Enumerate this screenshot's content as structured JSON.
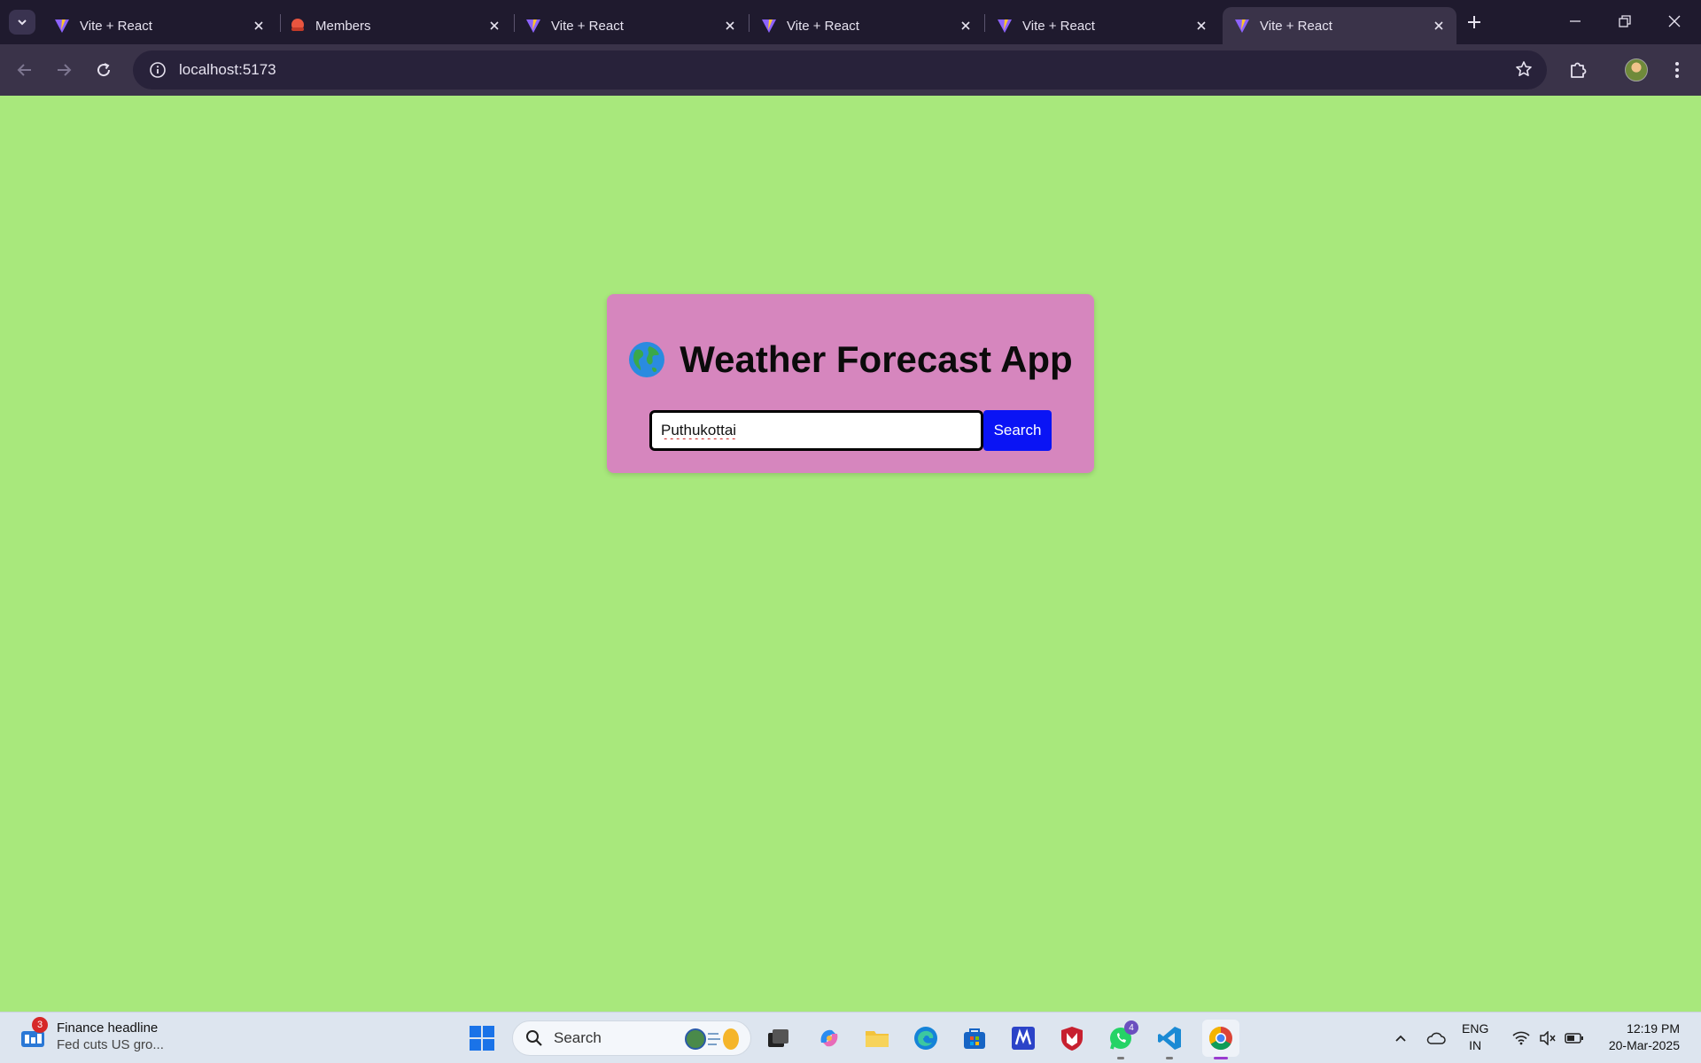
{
  "browser": {
    "tabs": [
      {
        "title": "Vite + React",
        "favicon": "vite-icon",
        "active": false
      },
      {
        "title": "Members",
        "favicon": "members-icon",
        "active": false
      },
      {
        "title": "Vite + React",
        "favicon": "vite-icon",
        "active": false
      },
      {
        "title": "Vite + React",
        "favicon": "vite-icon",
        "active": false
      },
      {
        "title": "Vite + React",
        "favicon": "vite-icon",
        "active": false
      },
      {
        "title": "Vite + React",
        "favicon": "vite-icon",
        "active": true
      }
    ],
    "url": "localhost:5173"
  },
  "app": {
    "title": "Weather Forecast App",
    "title_icon": "globe-icon",
    "search_value": "Puthukottai",
    "search_button": "Search",
    "colors": {
      "background": "#a8e87c",
      "card": "#d686be",
      "button": "#0a14f5"
    }
  },
  "taskbar": {
    "widget_badge": "3",
    "widget_title": "Finance headline",
    "widget_subtitle": "Fed cuts US gro...",
    "search_label": "Search",
    "whatsapp_badge": "4",
    "language_line1": "ENG",
    "language_line2": "IN",
    "time": "12:19 PM",
    "date": "20-Mar-2025"
  }
}
